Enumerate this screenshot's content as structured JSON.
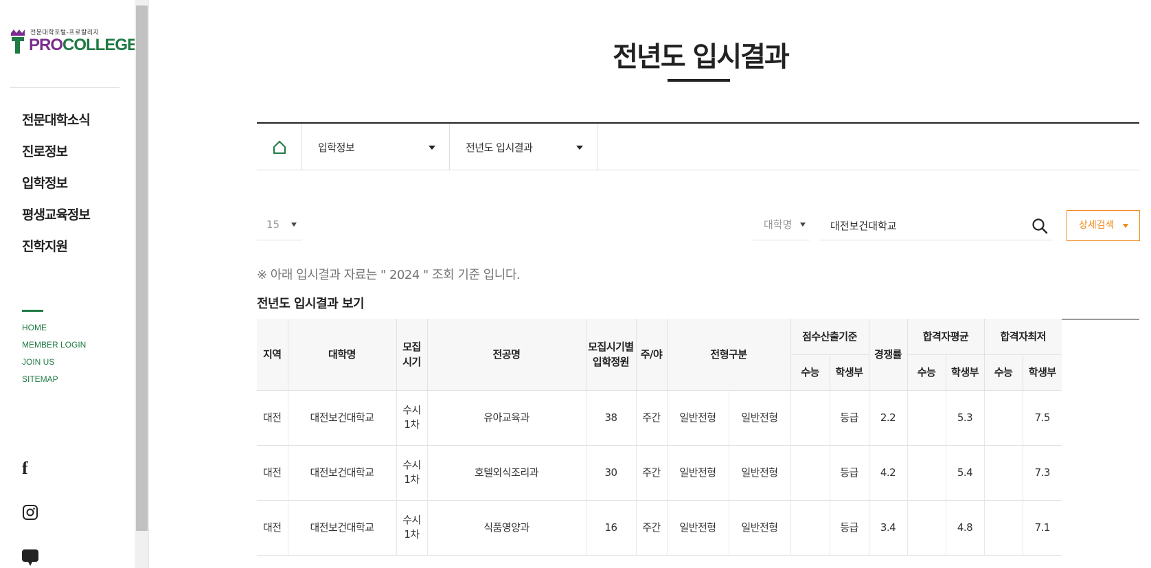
{
  "sidebar": {
    "logo_sub": "전문대학포털-프로칼리지",
    "logo_pro": "PRO",
    "logo_college": "COLLEGE",
    "nav": [
      "전문대학소식",
      "진로정보",
      "입학정보",
      "평생교육정보",
      "진학지원"
    ],
    "util_links": [
      "HOME",
      "MEMBER LOGIN",
      "JOIN US",
      "SITEMAP"
    ],
    "sns": {
      "facebook": "f"
    }
  },
  "page": {
    "title": "전년도 입시결과"
  },
  "breadcrumb": {
    "items": [
      "입학정보",
      "전년도 입시결과"
    ]
  },
  "search": {
    "per_page": "15",
    "type_label": "대학명",
    "query": "대전보건대학교",
    "detail_label": "상세검색"
  },
  "notice": "※ 아래 입시결과 자료는 \" 2024 \" 조회 기준 입니다.",
  "section_title": "전년도 입시결과 보기",
  "table": {
    "headers": {
      "region": "지역",
      "university": "대학명",
      "period_a": "모집",
      "period_b": "시기",
      "major": "전공명",
      "quota_a": "모집시기별",
      "quota_b": "입학정원",
      "daynight": "주/야",
      "admission_type": "전형구분",
      "score_basis": "점수산출기준",
      "competition": "경쟁률",
      "avg": "합격자평균",
      "min": "합격자최저",
      "suneung": "수능",
      "record": "학생부"
    },
    "rows": [
      {
        "region": "대전",
        "university": "대전보건대학교",
        "period_a": "수시",
        "period_b": "1차",
        "major": "유아교육과",
        "quota": "38",
        "daynight": "주간",
        "type1": "일반전형",
        "type2": "일반전형",
        "basis_suneung": "",
        "basis_record": "등급",
        "competition": "2.2",
        "avg_suneung": "",
        "avg_record": "5.3",
        "min_suneung": "",
        "min_record": "7.5"
      },
      {
        "region": "대전",
        "university": "대전보건대학교",
        "period_a": "수시",
        "period_b": "1차",
        "major": "호텔외식조리과",
        "quota": "30",
        "daynight": "주간",
        "type1": "일반전형",
        "type2": "일반전형",
        "basis_suneung": "",
        "basis_record": "등급",
        "competition": "4.2",
        "avg_suneung": "",
        "avg_record": "5.4",
        "min_suneung": "",
        "min_record": "7.3"
      },
      {
        "region": "대전",
        "university": "대전보건대학교",
        "period_a": "수시",
        "period_b": "1차",
        "major": "식품영양과",
        "quota": "16",
        "daynight": "주간",
        "type1": "일반전형",
        "type2": "일반전형",
        "basis_suneung": "",
        "basis_record": "등급",
        "competition": "3.4",
        "avg_suneung": "",
        "avg_record": "4.8",
        "min_suneung": "",
        "min_record": "7.1"
      }
    ]
  },
  "colors": {
    "brand_green": "#1f7a43",
    "brand_purple": "#7b2d8e",
    "accent_orange": "#f08a1c"
  }
}
